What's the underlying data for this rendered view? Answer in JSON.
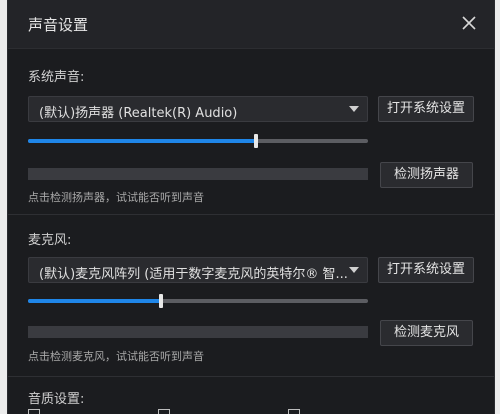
{
  "dialog": {
    "title": "声音设置",
    "close_icon": "close-icon"
  },
  "system_sound": {
    "label": "系统声音:",
    "device": "(默认)扬声器 (Realtek(R) Audio)",
    "open_settings_label": "打开系统设置",
    "volume_percent": 67,
    "test_button_label": "检测扬声器",
    "hint": "点击检测扬声器，试试能否听到声音"
  },
  "microphone": {
    "label": "麦克风:",
    "device": "(默认)麦克风阵列 (适用于数字麦克风的英特尔® 智...",
    "open_settings_label": "打开系统设置",
    "volume_percent": 39,
    "test_button_label": "检测麦克风",
    "hint": "点击检测麦克风，试试能否听到声音"
  },
  "quality": {
    "label": "音质设置:"
  },
  "colors": {
    "accent": "#1f86e8",
    "dialog_bg": "#1b1c1f",
    "titlebar_bg": "#232428"
  }
}
